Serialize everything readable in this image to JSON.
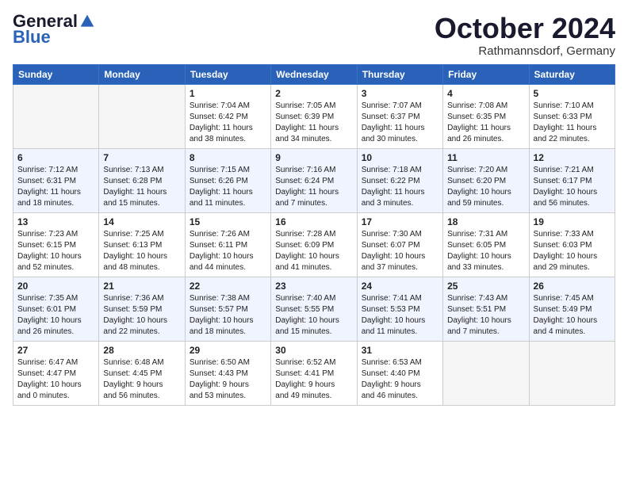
{
  "header": {
    "logo_general": "General",
    "logo_blue": "Blue",
    "month_title": "October 2024",
    "location": "Rathmannsdorf, Germany"
  },
  "weekdays": [
    "Sunday",
    "Monday",
    "Tuesday",
    "Wednesday",
    "Thursday",
    "Friday",
    "Saturday"
  ],
  "weeks": [
    [
      {
        "day": "",
        "info": ""
      },
      {
        "day": "",
        "info": ""
      },
      {
        "day": "1",
        "info": "Sunrise: 7:04 AM\nSunset: 6:42 PM\nDaylight: 11 hours\nand 38 minutes."
      },
      {
        "day": "2",
        "info": "Sunrise: 7:05 AM\nSunset: 6:39 PM\nDaylight: 11 hours\nand 34 minutes."
      },
      {
        "day": "3",
        "info": "Sunrise: 7:07 AM\nSunset: 6:37 PM\nDaylight: 11 hours\nand 30 minutes."
      },
      {
        "day": "4",
        "info": "Sunrise: 7:08 AM\nSunset: 6:35 PM\nDaylight: 11 hours\nand 26 minutes."
      },
      {
        "day": "5",
        "info": "Sunrise: 7:10 AM\nSunset: 6:33 PM\nDaylight: 11 hours\nand 22 minutes."
      }
    ],
    [
      {
        "day": "6",
        "info": "Sunrise: 7:12 AM\nSunset: 6:31 PM\nDaylight: 11 hours\nand 18 minutes."
      },
      {
        "day": "7",
        "info": "Sunrise: 7:13 AM\nSunset: 6:28 PM\nDaylight: 11 hours\nand 15 minutes."
      },
      {
        "day": "8",
        "info": "Sunrise: 7:15 AM\nSunset: 6:26 PM\nDaylight: 11 hours\nand 11 minutes."
      },
      {
        "day": "9",
        "info": "Sunrise: 7:16 AM\nSunset: 6:24 PM\nDaylight: 11 hours\nand 7 minutes."
      },
      {
        "day": "10",
        "info": "Sunrise: 7:18 AM\nSunset: 6:22 PM\nDaylight: 11 hours\nand 3 minutes."
      },
      {
        "day": "11",
        "info": "Sunrise: 7:20 AM\nSunset: 6:20 PM\nDaylight: 10 hours\nand 59 minutes."
      },
      {
        "day": "12",
        "info": "Sunrise: 7:21 AM\nSunset: 6:17 PM\nDaylight: 10 hours\nand 56 minutes."
      }
    ],
    [
      {
        "day": "13",
        "info": "Sunrise: 7:23 AM\nSunset: 6:15 PM\nDaylight: 10 hours\nand 52 minutes."
      },
      {
        "day": "14",
        "info": "Sunrise: 7:25 AM\nSunset: 6:13 PM\nDaylight: 10 hours\nand 48 minutes."
      },
      {
        "day": "15",
        "info": "Sunrise: 7:26 AM\nSunset: 6:11 PM\nDaylight: 10 hours\nand 44 minutes."
      },
      {
        "day": "16",
        "info": "Sunrise: 7:28 AM\nSunset: 6:09 PM\nDaylight: 10 hours\nand 41 minutes."
      },
      {
        "day": "17",
        "info": "Sunrise: 7:30 AM\nSunset: 6:07 PM\nDaylight: 10 hours\nand 37 minutes."
      },
      {
        "day": "18",
        "info": "Sunrise: 7:31 AM\nSunset: 6:05 PM\nDaylight: 10 hours\nand 33 minutes."
      },
      {
        "day": "19",
        "info": "Sunrise: 7:33 AM\nSunset: 6:03 PM\nDaylight: 10 hours\nand 29 minutes."
      }
    ],
    [
      {
        "day": "20",
        "info": "Sunrise: 7:35 AM\nSunset: 6:01 PM\nDaylight: 10 hours\nand 26 minutes."
      },
      {
        "day": "21",
        "info": "Sunrise: 7:36 AM\nSunset: 5:59 PM\nDaylight: 10 hours\nand 22 minutes."
      },
      {
        "day": "22",
        "info": "Sunrise: 7:38 AM\nSunset: 5:57 PM\nDaylight: 10 hours\nand 18 minutes."
      },
      {
        "day": "23",
        "info": "Sunrise: 7:40 AM\nSunset: 5:55 PM\nDaylight: 10 hours\nand 15 minutes."
      },
      {
        "day": "24",
        "info": "Sunrise: 7:41 AM\nSunset: 5:53 PM\nDaylight: 10 hours\nand 11 minutes."
      },
      {
        "day": "25",
        "info": "Sunrise: 7:43 AM\nSunset: 5:51 PM\nDaylight: 10 hours\nand 7 minutes."
      },
      {
        "day": "26",
        "info": "Sunrise: 7:45 AM\nSunset: 5:49 PM\nDaylight: 10 hours\nand 4 minutes."
      }
    ],
    [
      {
        "day": "27",
        "info": "Sunrise: 6:47 AM\nSunset: 4:47 PM\nDaylight: 10 hours\nand 0 minutes."
      },
      {
        "day": "28",
        "info": "Sunrise: 6:48 AM\nSunset: 4:45 PM\nDaylight: 9 hours\nand 56 minutes."
      },
      {
        "day": "29",
        "info": "Sunrise: 6:50 AM\nSunset: 4:43 PM\nDaylight: 9 hours\nand 53 minutes."
      },
      {
        "day": "30",
        "info": "Sunrise: 6:52 AM\nSunset: 4:41 PM\nDaylight: 9 hours\nand 49 minutes."
      },
      {
        "day": "31",
        "info": "Sunrise: 6:53 AM\nSunset: 4:40 PM\nDaylight: 9 hours\nand 46 minutes."
      },
      {
        "day": "",
        "info": ""
      },
      {
        "day": "",
        "info": ""
      }
    ]
  ]
}
